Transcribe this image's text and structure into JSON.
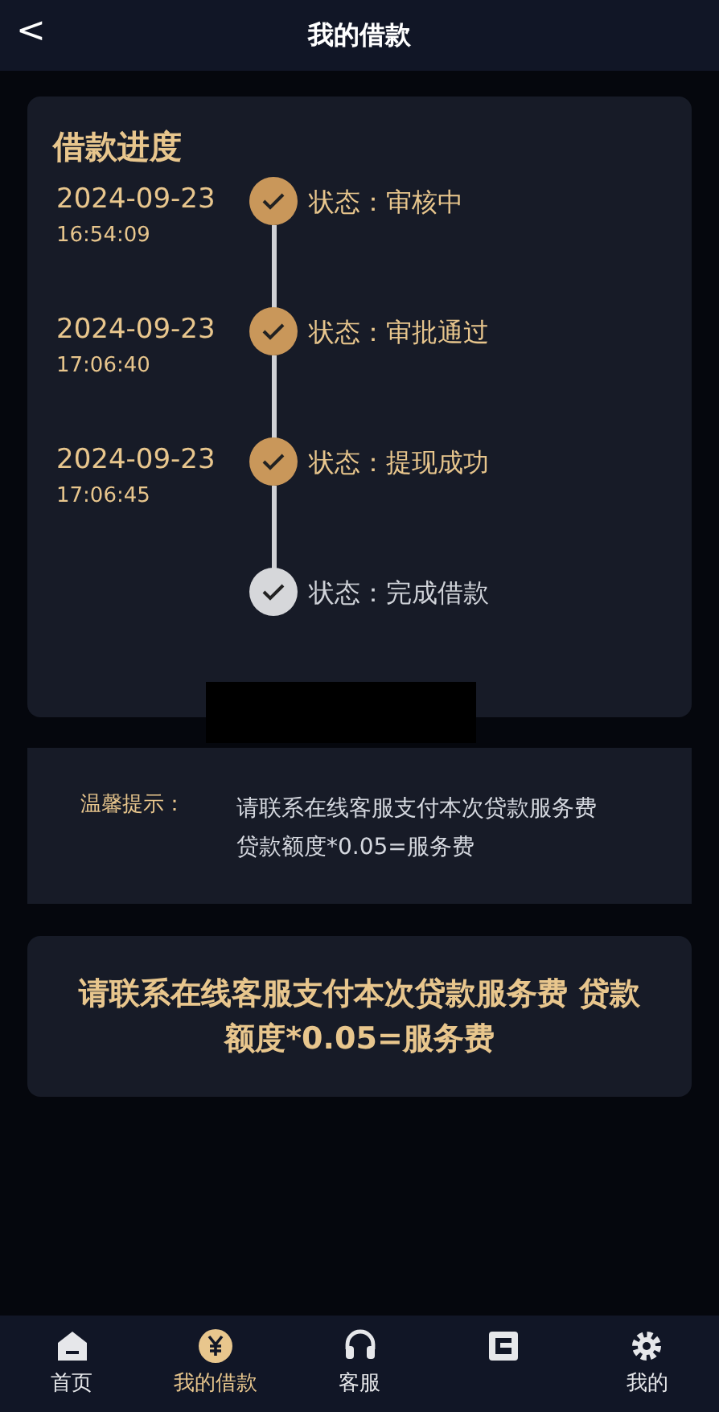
{
  "header": {
    "back": "<",
    "title": "我的借款"
  },
  "progress": {
    "title": "借款进度",
    "steps": [
      {
        "date": "2024-09-23",
        "time": "16:54:09",
        "status": "状态：审核中",
        "done": true
      },
      {
        "date": "2024-09-23",
        "time": "17:06:40",
        "status": "状态：审批通过",
        "done": true
      },
      {
        "date": "2024-09-23",
        "time": "17:06:45",
        "status": "状态：提现成功",
        "done": true
      },
      {
        "status": "状态：完成借款",
        "done": false
      }
    ]
  },
  "tip": {
    "label": "温馨提示：",
    "lines": [
      "请联系在线客服支付本次贷款服务费",
      "贷款额度*0.05=服务费"
    ]
  },
  "notice": "请联系在线客服支付本次贷款服务费 贷款额度*0.05=服务费",
  "tabs": [
    {
      "kind": "home",
      "label": "首页",
      "selected": false
    },
    {
      "kind": "loan",
      "label": "我的借款",
      "selected": true
    },
    {
      "kind": "service",
      "label": "客服",
      "selected": false
    },
    {
      "kind": "wallet",
      "selected": false
    },
    {
      "kind": "gear",
      "label": "我的",
      "selected": false
    }
  ]
}
